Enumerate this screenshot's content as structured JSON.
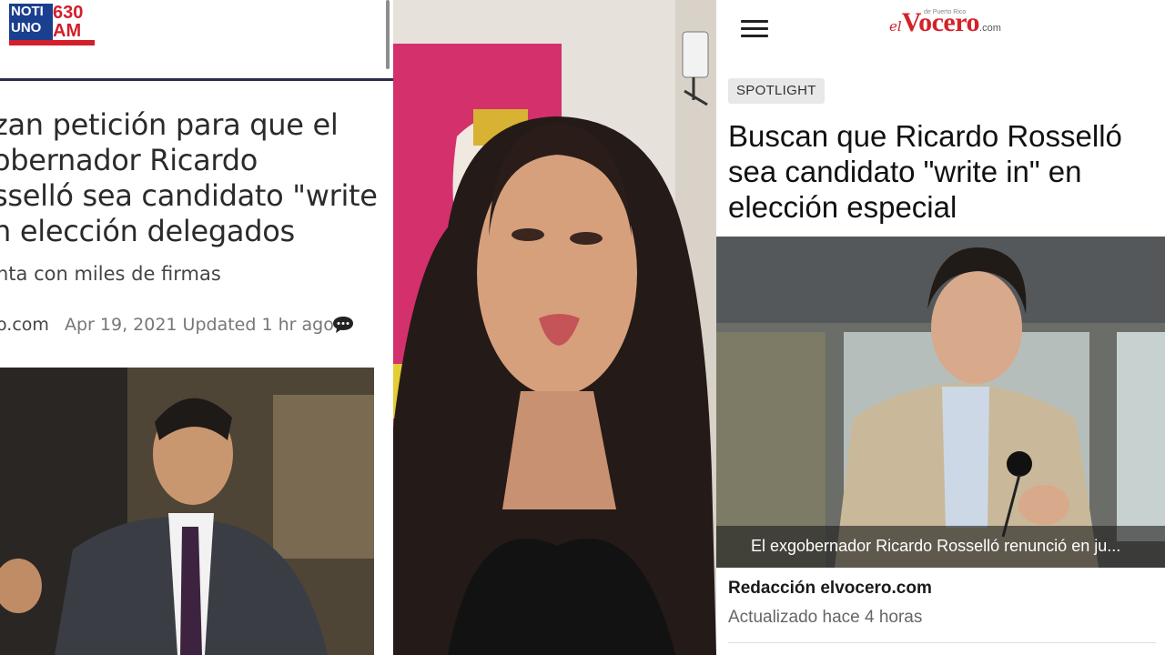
{
  "left_article": {
    "logo": {
      "noti_uno": "NOTI UNO",
      "station": "630 AM"
    },
    "headline": "zan petición para que el\nobernador Ricardo\nsselló sea candidato \"write\nn elección delegados",
    "subhead": "nta con miles de firmas",
    "source": "o.com",
    "date": "Apr 19, 2021 Updated 1 hr ago",
    "photo_alt": "Ricardo Rosselló speaking"
  },
  "middle_video": {
    "alt": "Woman speaking to camera"
  },
  "right_article": {
    "logo": {
      "prefix": "el",
      "brand": "Vocero",
      "suffix": ".com",
      "tag": "de Puerto Rico"
    },
    "category": "SPOTLIGHT",
    "headline": "Buscan que Ricardo Rosselló sea candidato \"write in\" en elección especial",
    "photo_caption": "El exgobernador Ricardo Rosselló renunció en ju...",
    "author": "Redacción elvocero.com",
    "updated": "Actualizado hace 4 horas"
  },
  "colors": {
    "noti_blue": "#1a3f8f",
    "noti_red": "#d21f2b",
    "vocero_red": "#d4222a"
  }
}
